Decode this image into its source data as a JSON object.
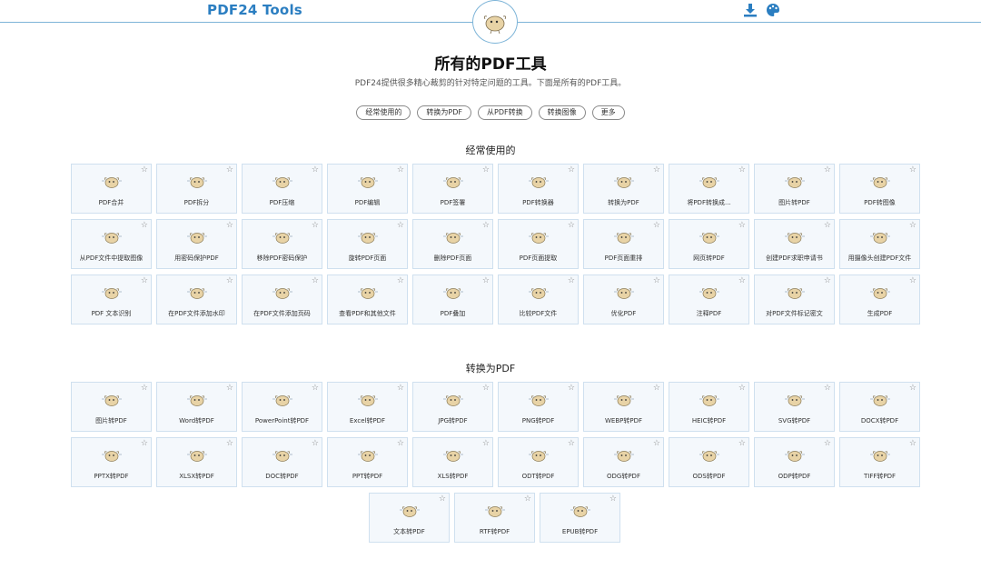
{
  "header": {
    "logo": "PDF24 Tools",
    "download_icon": "download-icon",
    "theme_icon": "palette-icon",
    "mascot_icon": "mascot-icon"
  },
  "title": "所有的PDF工具",
  "subtitle": "PDF24提供很多精心裁剪的针对特定问题的工具。下面是所有的PDF工具。",
  "filters": [
    "经常使用的",
    "转换为PDF",
    "从PDF转换",
    "转换图像",
    "更多"
  ],
  "sections": [
    {
      "title": "经常使用的",
      "tools": [
        "PDF合并",
        "PDF拆分",
        "PDF压缩",
        "PDF编辑",
        "PDF签署",
        "PDF转换器",
        "转换为PDF",
        "将PDF转换成...",
        "图片转PDF",
        "PDF转图像",
        "从PDF文件中提取图像",
        "用密码保护PDF",
        "移除PDF密码保护",
        "旋转PDF页面",
        "删除PDF页面",
        "PDF页面提取",
        "PDF页面重排",
        "网页转PDF",
        "创建PDF求职申请书",
        "用摄像头创建PDF文件",
        "PDF 文本识别",
        "在PDF文件添加水印",
        "在PDF文件添加页码",
        "查看PDF和其他文件",
        "PDF叠加",
        "比较PDF文件",
        "优化PDF",
        "注释PDF",
        "对PDF文件标记密文",
        "生成PDF"
      ]
    },
    {
      "title": "转换为PDF",
      "tools": [
        "图片转PDF",
        "Word转PDF",
        "PowerPoint转PDF",
        "Excel转PDF",
        "JPG转PDF",
        "PNG转PDF",
        "WEBP转PDF",
        "HEIC转PDF",
        "SVG转PDF",
        "DOCX转PDF",
        "PPTX转PDF",
        "XLSX转PDF",
        "DOC转PDF",
        "PPT转PDF",
        "XLS转PDF",
        "ODT转PDF",
        "ODG转PDF",
        "ODS转PDF",
        "ODP转PDF",
        "TIFF转PDF",
        "文本转PDF",
        "RTF转PDF",
        "EPUB转PDF"
      ]
    }
  ],
  "star_glyph": "☆",
  "colors": {
    "brand": "#2b7ec1",
    "tile_bg": "#f4f8fc",
    "tile_border": "#cfe0ef"
  }
}
